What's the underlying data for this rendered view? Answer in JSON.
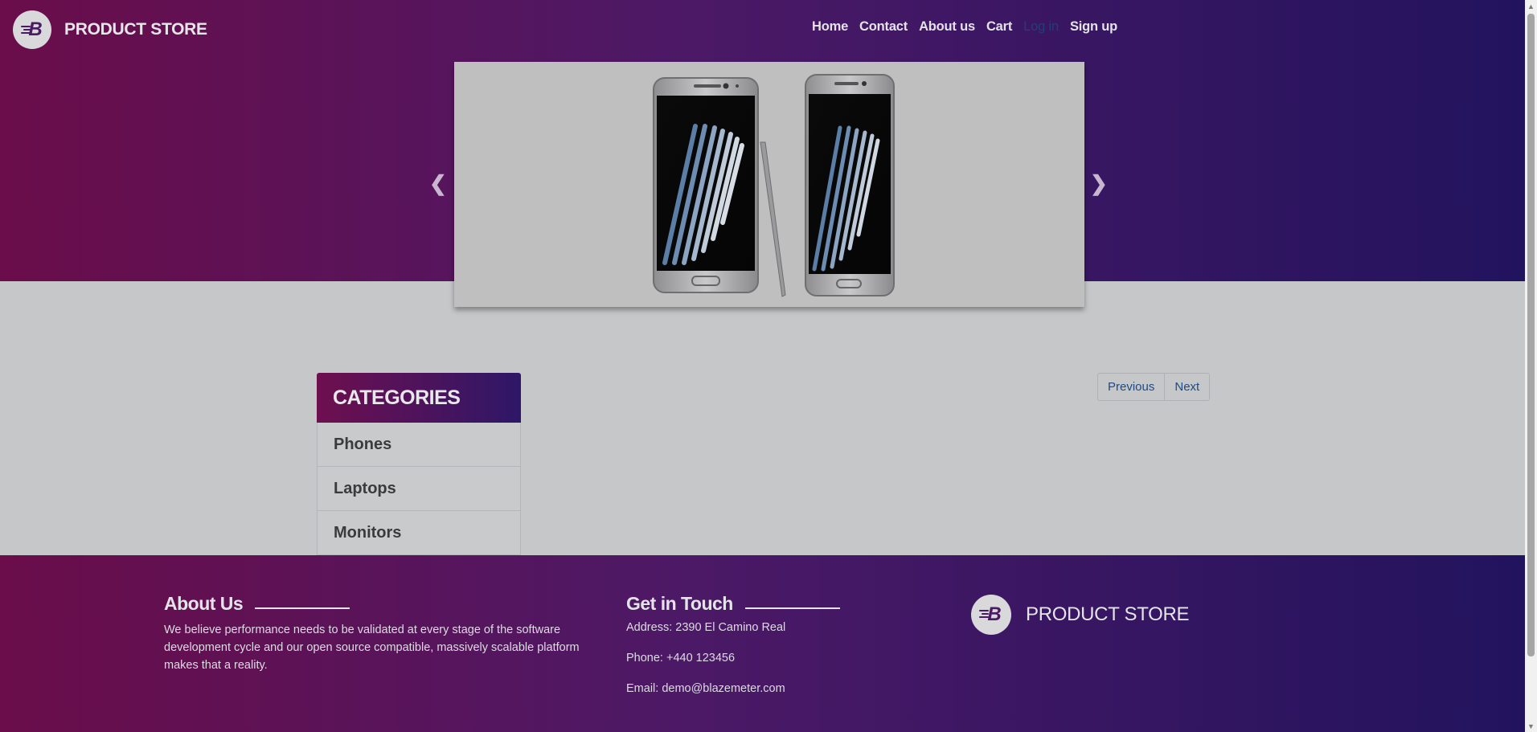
{
  "brand": {
    "name": "PRODUCT STORE",
    "logo_letter": "B"
  },
  "nav": {
    "items": [
      {
        "label": "Home"
      },
      {
        "label": "Contact"
      },
      {
        "label": "About us"
      },
      {
        "label": "Cart"
      },
      {
        "label": "Log in"
      },
      {
        "label": "Sign up"
      }
    ]
  },
  "carousel": {
    "prev_icon": "chevron-left-icon",
    "next_icon": "chevron-right-icon"
  },
  "categories": {
    "title": "CATEGORIES",
    "items": [
      {
        "label": "Phones"
      },
      {
        "label": "Laptops"
      },
      {
        "label": "Monitors"
      }
    ]
  },
  "pager": {
    "previous_label": "Previous",
    "next_label": "Next"
  },
  "footer": {
    "about": {
      "title": "About Us",
      "text": "We believe performance needs to be validated at every stage of the software development cycle and our open source compatible, massively scalable platform makes that a reality."
    },
    "touch": {
      "title": "Get in Touch",
      "address": "Address: 2390 El Camino Real",
      "phone": "Phone: +440 123456",
      "email": "Email: demo@blazemeter.com"
    },
    "brand": "PRODUCT STORE"
  },
  "colors": {
    "gradient_start": "#6a0d4a",
    "gradient_end": "#22135e",
    "link_blue": "#1e4a86"
  }
}
